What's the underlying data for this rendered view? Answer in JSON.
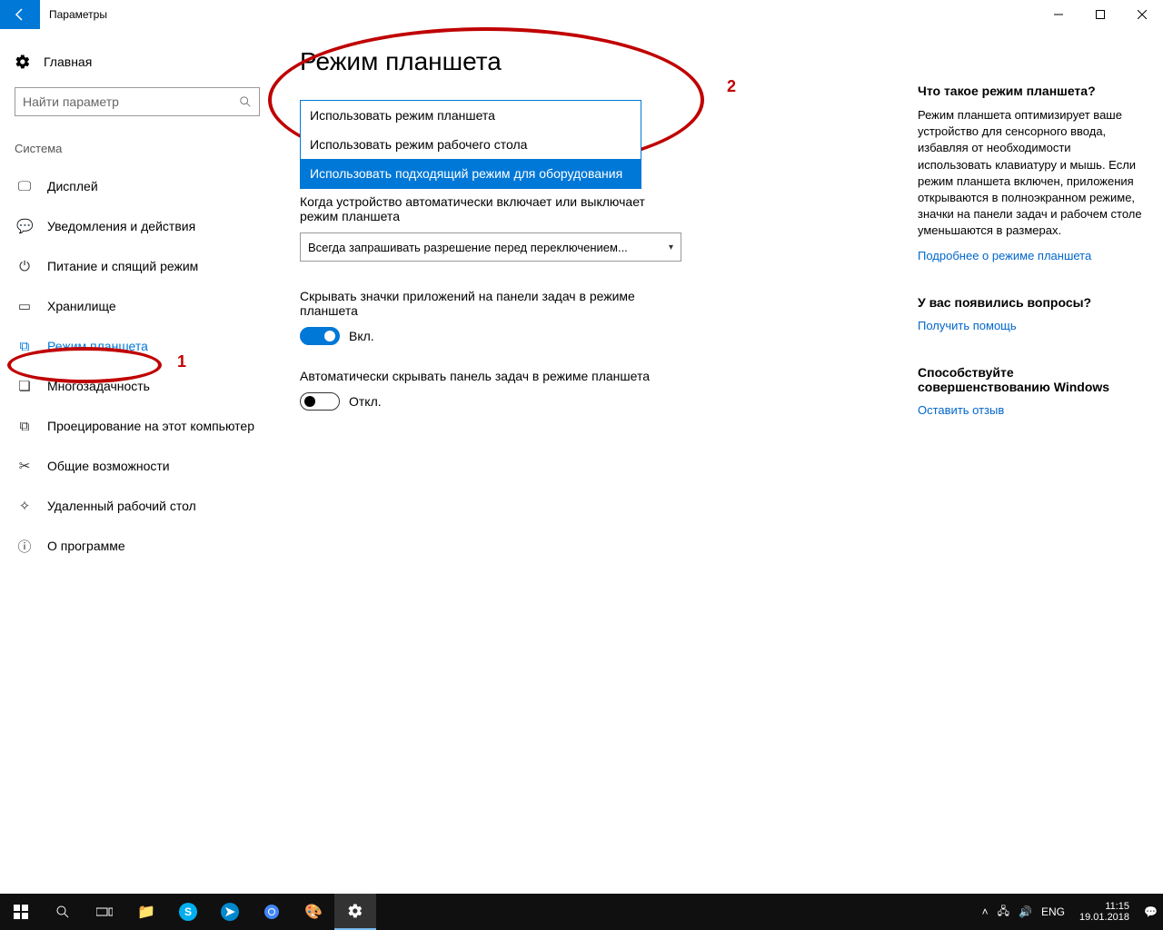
{
  "window": {
    "title": "Параметры"
  },
  "sidebar": {
    "home": "Главная",
    "search_placeholder": "Найти параметр",
    "section": "Система",
    "items": [
      {
        "label": "Дисплей"
      },
      {
        "label": "Уведомления и действия"
      },
      {
        "label": "Питание и спящий режим"
      },
      {
        "label": "Хранилище"
      },
      {
        "label": "Режим планшета"
      },
      {
        "label": "Многозадачность"
      },
      {
        "label": "Проецирование на этот компьютер"
      },
      {
        "label": "Общие возможности"
      },
      {
        "label": "Удаленный рабочий стол"
      },
      {
        "label": "О программе"
      }
    ]
  },
  "content": {
    "title": "Режим планшета",
    "dropdown": {
      "opt0": "Использовать режим планшета",
      "opt1": "Использовать режим рабочего стола",
      "opt2": "Использовать подходящий режим для оборудования"
    },
    "setting2_label": "Когда устройство автоматически включает или выключает режим планшета",
    "setting2_value": "Всегда запрашивать разрешение перед переключением...",
    "setting3_label": "Скрывать значки приложений на панели задач в режиме планшета",
    "setting3_state": "Вкл.",
    "setting4_label": "Автоматически скрывать панель задач в режиме планшета",
    "setting4_state": "Откл."
  },
  "right": {
    "h1": "Что такое режим планшета?",
    "p1": "Режим планшета оптимизирует ваше устройство для сенсорного ввода, избавляя от необходимости использовать клавиатуру и мышь. Если режим планшета включен, приложения открываются в полноэкранном режиме, значки на панели задач и рабочем столе уменьшаются в размерах.",
    "link1": "Подробнее о режиме планшета",
    "h2": "У вас появились вопросы?",
    "link2": "Получить помощь",
    "h3": "Способствуйте совершенствованию Windows",
    "link3": "Оставить отзыв"
  },
  "annotations": {
    "n1": "1",
    "n2": "2"
  },
  "taskbar": {
    "lang": "ENG",
    "time": "11:15",
    "date": "19.01.2018"
  }
}
